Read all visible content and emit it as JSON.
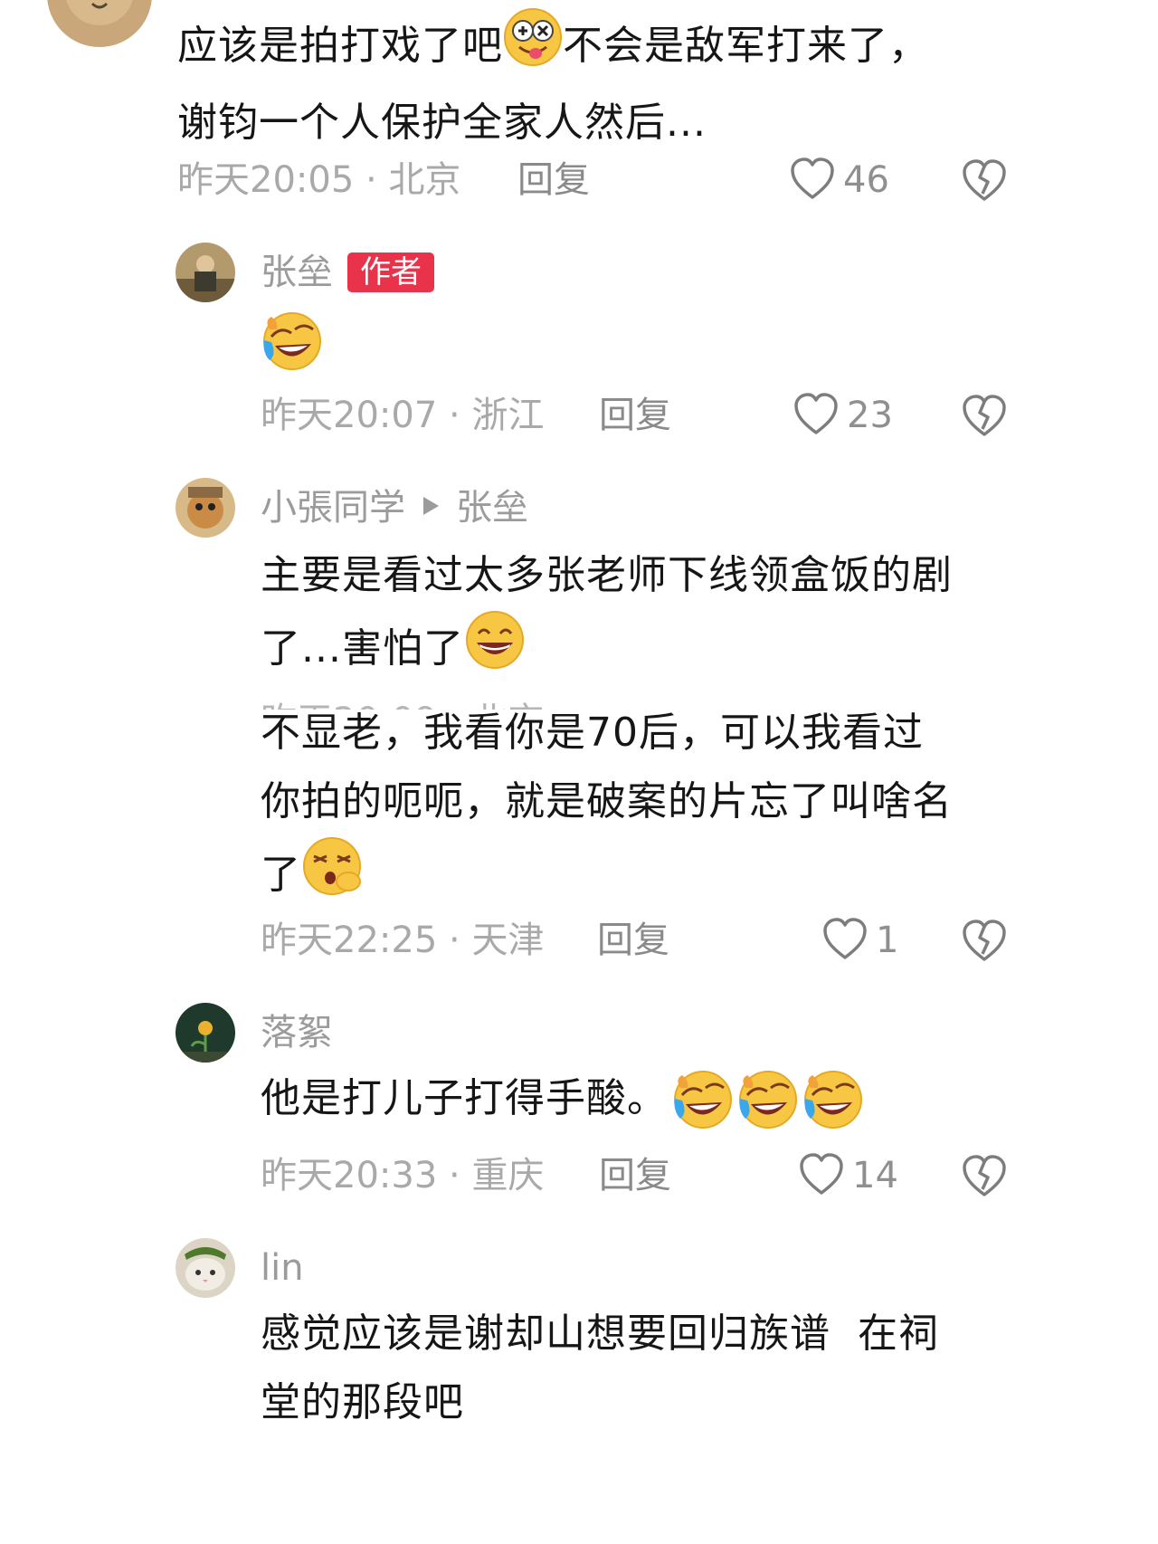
{
  "comments": [
    {
      "text": "应该是拍打戏了吧",
      "text_after_emoji": "不会是敌军打来了，",
      "text_line2": "谢钧一个人保护全家人然后...",
      "time": "昨天20:05",
      "dot": "·",
      "location": "北京",
      "reply": "回复",
      "likes": "46"
    },
    {
      "username": "张垒",
      "badge": "作者",
      "time": "昨天20:07",
      "dot": "·",
      "location": "浙江",
      "reply": "回复",
      "likes": "23"
    },
    {
      "username": "小張同学",
      "reply_to": "张垒",
      "text_line1": "主要是看过太多张老师下线领盒饭的剧",
      "text_line2": "了...害怕了",
      "partial_meta": "昨天20:09 · 北京"
    },
    {
      "text_line1": "不显老，我看你是70后，可以我看过",
      "text_line2": "你拍的呃呃，就是破案的片忘了叫啥名",
      "text_line3": "了",
      "time": "昨天22:25",
      "dot": "·",
      "location": "天津",
      "reply": "回复",
      "likes": "1"
    },
    {
      "username": "落絮",
      "text": "他是打儿子打得手酸。",
      "time": "昨天20:33",
      "dot": "·",
      "location": "重庆",
      "reply": "回复",
      "likes": "14"
    },
    {
      "username": "lin",
      "text_line1": "感觉应该是谢却山想要回归族谱  在祠",
      "text_line2": "堂的那段吧"
    }
  ],
  "icons": {
    "like": "heart-outline-icon",
    "dislike": "broken-heart-icon",
    "reply_arrow": "play-triangle-icon"
  },
  "colors": {
    "badge": "#e8334a",
    "text": "#161616",
    "meta": "#a9a9a9"
  }
}
